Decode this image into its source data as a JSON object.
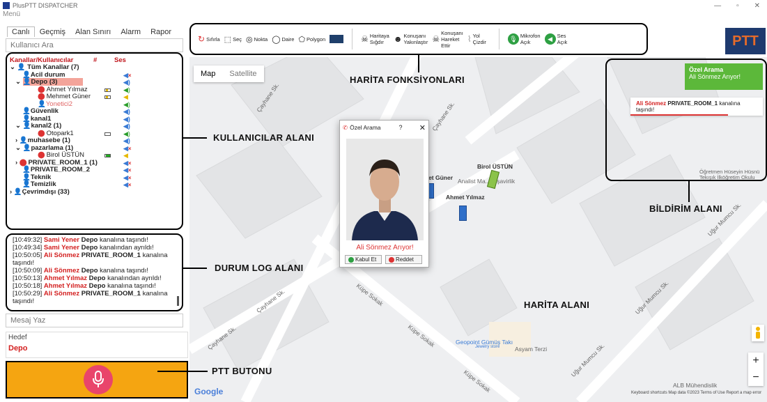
{
  "app": {
    "title": "PlusPTT DISPATCHER",
    "menu": "Menü"
  },
  "left": {
    "tabs": [
      "Canlı",
      "Geçmiş",
      "Alan Sınırı",
      "Alarm",
      "Rapor"
    ],
    "search_placeholder": "Kullanıcı Ara",
    "tree": {
      "headers": {
        "name": "Kanallar/Kullanıcılar",
        "count": "#",
        "sound": "Ses"
      },
      "rows": [
        {
          "label": "Tüm Kanallar (7)"
        },
        {
          "label": "Acil durum"
        },
        {
          "label": "Depo (3)"
        },
        {
          "label": "Ahmet Yılmaz"
        },
        {
          "label": "Mehmet Güner"
        },
        {
          "label": "Yonetici2"
        },
        {
          "label": "Güvenlik"
        },
        {
          "label": "kanal1"
        },
        {
          "label": "kanal2 (1)"
        },
        {
          "label": "Otopark1"
        },
        {
          "label": "muhasebe (1)"
        },
        {
          "label": "pazarlama (1)"
        },
        {
          "label": "Birol ÜSTÜN"
        },
        {
          "label": "PRIVATE_ROOM_1 (1)"
        },
        {
          "label": "PRIVATE_ROOM_2"
        },
        {
          "label": "Teknik"
        },
        {
          "label": "Temizlik"
        },
        {
          "label": "Çevrimdışı (33)"
        }
      ]
    },
    "log": [
      {
        "time": "[10:49:32]",
        "name": "Sami Yener",
        "channel": "Depo",
        "text": "kanalına taşındı!"
      },
      {
        "time": "[10:49:34]",
        "name": "Sami Yener",
        "channel": "Depo",
        "text": "kanalından ayrıldı!"
      },
      {
        "time": "[10:50:05]",
        "name": "Ali Sönmez",
        "channel": "PRIVATE_ROOM_1",
        "text": "kanalına taşındı!"
      },
      {
        "time": "[10:50:09]",
        "name": "Ali Sönmez",
        "channel": "Depo",
        "text": "kanalına taşındı!"
      },
      {
        "time": "[10:50:13]",
        "name": "Ahmet Yılmaz",
        "channel": "Depo",
        "text": "kanalından ayrıldı!"
      },
      {
        "time": "[10:50:18]",
        "name": "Ahmet Yılmaz",
        "channel": "Depo",
        "text": "kanalına taşındı!"
      },
      {
        "time": "[10:50:29]",
        "name": "Ali Sönmez",
        "channel": "PRIVATE_ROOM_1",
        "text": "kanalına taşındı!"
      }
    ],
    "message_placeholder": "Mesaj Yaz",
    "target_label": "Hedef",
    "target_value": "Depo"
  },
  "toolbar": {
    "reset": "Sıfırla",
    "select": "Seç",
    "point": "Nokta",
    "circle": "Daire",
    "polygon": "Polygon",
    "fit_map": [
      "Haritaya",
      "Sığdır"
    ],
    "zoom_talk": [
      "Konuşanı",
      "Yakınlaştır"
    ],
    "follow_talk": [
      "Konuşanı",
      "Hareket",
      "Ettir"
    ],
    "draw_road": [
      "Yol",
      "Çizdir"
    ],
    "mic": [
      "Mikrofon",
      "Açık"
    ],
    "sound": [
      "Ses",
      "Açık"
    ],
    "logo": "PTT",
    "polygon_color": "#1f3f6b"
  },
  "map": {
    "type_map": "Map",
    "type_sat": "Satellite",
    "streets": [
      "Çayhane Sk.",
      "Çayhane Sk.",
      "Çayhane Sk.",
      "Çayhane Sk.",
      "Küpe Sokak",
      "Küpe Sokak",
      "Küpe Sokak",
      "Uğur Mumcu Sk.",
      "Uğur Mumcu Sk.",
      "Uğur Mumcu Sk."
    ],
    "pois": [
      "Analist Ma... ...şavirlik",
      "Geopoint Gümüş Takı",
      "Jewelry store",
      "Asyam Terzi",
      "ALB Mühendislik",
      "Öğretmen Hüseyin Hüsnü",
      "Tekışık İlköğretim Okulu"
    ],
    "users": [
      "Birol ÜSTÜN",
      "Ahmet Yılmaz",
      "...et Güner"
    ],
    "attribution": "Keyboard shortcuts   Map data ©2023   Terms of Use   Report a map error",
    "google": "Google"
  },
  "call_dialog": {
    "title": "Özel Arama",
    "help": "?",
    "close": "✕",
    "caller_text": "Ali Sönmez Arıyor!",
    "accept": "Kabul Et",
    "reject": "Reddet"
  },
  "notifications": {
    "green_title": "Özel Arama",
    "green_sub": "Ali Sönmez Arıyor!",
    "card_name": "Ali Sönmez",
    "card_channel": "PRIVATE_ROOM_1",
    "card_text": "kanalına taşındı!"
  },
  "annotations": {
    "functions": "HARİTA FONKSİYONLARI",
    "users": "KULLANICILAR ALANI",
    "log": "DURUM LOG ALANI",
    "ptt": "PTT BUTONU",
    "notif": "BİLDİRİM ALANI",
    "map": "HARİTA ALANI"
  }
}
